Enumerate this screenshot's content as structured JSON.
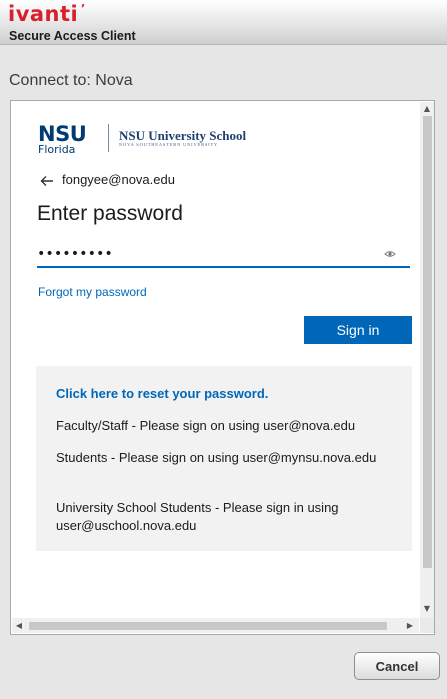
{
  "app": {
    "brand": "ivanti",
    "subtitle": "Secure Access Client"
  },
  "connect_label": "Connect to: Nova",
  "login": {
    "logo_primary": "NSU",
    "logo_secondary": "Florida",
    "school_name": "NSU University School",
    "school_tagline": "NOVA SOUTHEASTERN UNIVERSITY",
    "email": "fongyee@nova.edu",
    "heading": "Enter password",
    "password_value": "•••••••••",
    "forgot_link": "Forgot my password",
    "signin_label": "Sign in"
  },
  "info": {
    "reset_link": "Click here to reset your password.",
    "lines": [
      "Faculty/Staff - Please sign on using user@nova.edu",
      "Students - Please sign on using user@mynsu.nova.edu",
      "University School Students - Please sign in using user@uschool.nova.edu"
    ]
  },
  "footer": {
    "cancel_label": "Cancel"
  },
  "colors": {
    "brand_red": "#d6212b",
    "accent_blue": "#0067b8",
    "nsu_navy": "#003c71"
  }
}
